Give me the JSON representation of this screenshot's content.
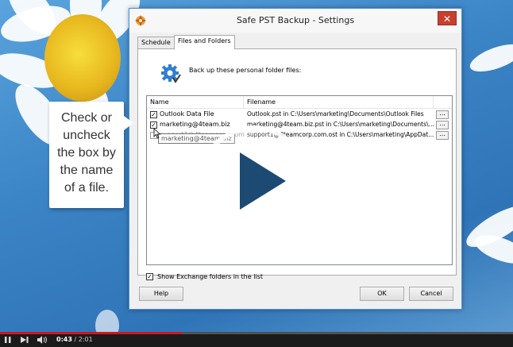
{
  "window": {
    "title": "Safe PST Backup - Settings",
    "close_glyph": "✕"
  },
  "tabs": [
    {
      "label": "Schedule",
      "active": false
    },
    {
      "label": "Files and Folders",
      "active": true
    }
  ],
  "panel": {
    "intro": "Back up these personal folder files:",
    "columns": {
      "name": "Name",
      "filename": "Filename"
    },
    "rows": [
      {
        "checked": true,
        "name": "Outlook Data File",
        "filename": "Outlook.pst in C:\\Users\\marketing\\Documents\\Outlook Files",
        "browse": "..."
      },
      {
        "checked": true,
        "name": "marketing@4team.biz",
        "filename": "marketing@4team.biz.pst in C:\\Users\\marketing\\Documents\\...",
        "browse": "..."
      },
      {
        "checked": false,
        "name": "support1@4teamcorp.com",
        "filename": "support1@4teamcorp.com.ost in C:\\Users\\marketing\\AppDat...",
        "browse": "..."
      }
    ],
    "tooltip": "marketing@4team.biz",
    "exchange": {
      "checked": true,
      "label": "Show Exchange folders in the list"
    }
  },
  "buttons": {
    "help": "Help",
    "ok": "OK",
    "cancel": "Cancel"
  },
  "callout": {
    "lines": [
      "Check or",
      "uncheck",
      "the box by",
      "the name",
      "of a file."
    ]
  },
  "player": {
    "current_time": "0:43",
    "separator": " / ",
    "duration": "2:01",
    "progress_fraction": 0.355,
    "icons": [
      "pause-icon",
      "next-icon",
      "volume-icon",
      "play-overlay-icon"
    ]
  },
  "colors": {
    "window_border": "#4d8ed2",
    "close_button": "#c7402f",
    "play_triangle": "#1d4a73",
    "progress": "#cc181e"
  }
}
